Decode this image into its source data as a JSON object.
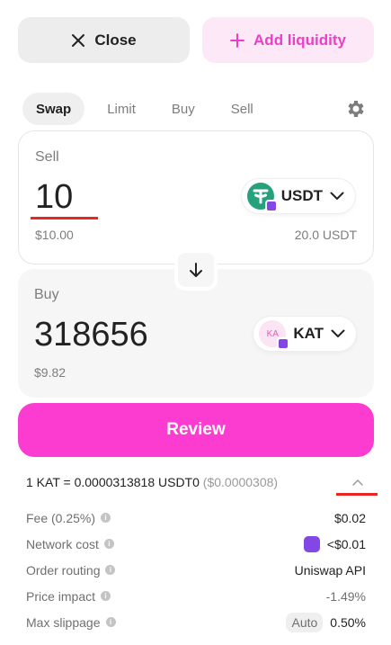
{
  "header": {
    "close_label": "Close",
    "add_liquidity_label": "Add liquidity"
  },
  "tabs": [
    {
      "label": "Swap",
      "active": true
    },
    {
      "label": "Limit",
      "active": false
    },
    {
      "label": "Buy",
      "active": false
    },
    {
      "label": "Sell",
      "active": false
    }
  ],
  "sell": {
    "label": "Sell",
    "amount": "10",
    "usd_value": "$10.00",
    "token": "USDT",
    "balance": "20.0 USDT",
    "token_icon": "usdt-logo"
  },
  "buy": {
    "label": "Buy",
    "amount": "318656",
    "usd_value": "$9.82",
    "token": "KAT",
    "token_icon_text": "KA"
  },
  "review_label": "Review",
  "rate": {
    "text": "1 KAT = 0.0000313818 USDT0",
    "fiat": "($0.0000308)"
  },
  "details": [
    {
      "label": "Fee (0.25%)",
      "value": "$0.02"
    },
    {
      "label": "Network cost",
      "value": "<$0.01",
      "icon": "polygon-network-icon"
    },
    {
      "label": "Order routing",
      "value": "Uniswap API"
    },
    {
      "label": "Price impact",
      "value": "-1.49%",
      "muted": true
    },
    {
      "label": "Max slippage",
      "badge": "Auto",
      "value": "0.50%"
    }
  ],
  "colors": {
    "accent_pink": "#fc3cd0",
    "add_liquidity_bg": "#fde8f7",
    "add_liquidity_text": "#ee3ec9",
    "usdt_green": "#26a17b",
    "polygon_purple": "#8247e5",
    "annotation_red": "#e8281f"
  }
}
